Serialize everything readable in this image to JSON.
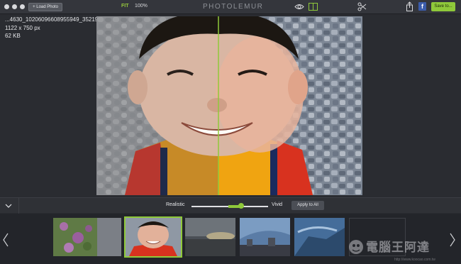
{
  "titlebar": {
    "load_label": "+ Load Photo",
    "fit_label": "FIT",
    "zoom": "100%",
    "brand": "PHOTOLEMUR",
    "save_label": "Save to...",
    "facebook_glyph": "f",
    "icons": [
      "eye-icon",
      "split-view-icon",
      "scissors-icon",
      "share-icon",
      "facebook-icon"
    ]
  },
  "file_info": {
    "filename": "...4630_10206096608955949_3521909024492310117_o.jpg",
    "dimensions": "1122 x 750  px",
    "size": "62 KB"
  },
  "controls": {
    "realistic_label": "Realistic",
    "vivid_label": "Vivid",
    "apply_label": "Apply to All",
    "intensity": 0.65
  },
  "watermark": {
    "text": "電腦王阿達",
    "url": "http://www.koocao.com.tw"
  },
  "colors": {
    "accent": "#8fc93a",
    "background": "#2a2c31",
    "facebook": "#3b5cab"
  }
}
